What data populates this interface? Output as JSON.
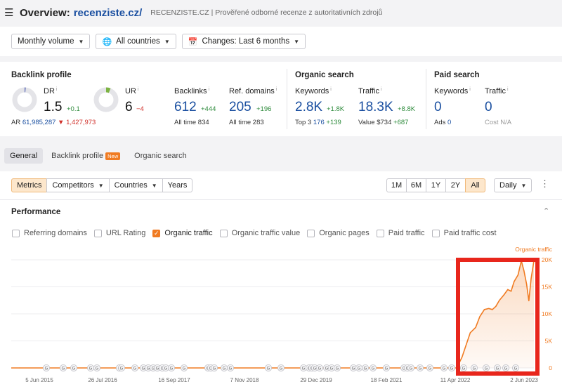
{
  "header": {
    "title_prefix": "Overview:",
    "domain": "recenziste.cz/",
    "description": "RECENZISTE.CZ | Prověřené odborné recenze z autoritativních zdrojů"
  },
  "filters": {
    "volume": "Monthly volume",
    "countries": "All countries",
    "changes": "Changes: Last 6 months"
  },
  "backlink_profile": {
    "title": "Backlink profile",
    "dr": {
      "label": "DR",
      "value": "1.5",
      "delta": "+0.1",
      "gauge_fraction": 0.015
    },
    "ur": {
      "label": "UR",
      "value": "6",
      "delta": "−4",
      "gauge_fraction": 0.06
    },
    "ar": {
      "label": "AR",
      "value": "61,985,287",
      "delta": "1,427,973"
    },
    "backlinks": {
      "label": "Backlinks",
      "value": "612",
      "delta": "+444",
      "all_time_label": "All time",
      "all_time": "834"
    },
    "ref_domains": {
      "label": "Ref. domains",
      "value": "205",
      "delta": "+196",
      "all_time_label": "All time",
      "all_time": "283"
    }
  },
  "organic_search": {
    "title": "Organic search",
    "keywords": {
      "label": "Keywords",
      "value": "2.8K",
      "delta": "+1.8K",
      "top3_label": "Top 3",
      "top3": "176",
      "top3_delta": "+139"
    },
    "traffic": {
      "label": "Traffic",
      "value": "18.3K",
      "delta": "+8.8K",
      "value_label": "Value",
      "value_amount": "$734",
      "value_delta": "+687"
    }
  },
  "paid_search": {
    "title": "Paid search",
    "keywords": {
      "label": "Keywords",
      "value": "0",
      "ads_label": "Ads",
      "ads": "0"
    },
    "traffic": {
      "label": "Traffic",
      "value": "0",
      "cost_label": "Cost",
      "cost": "N/A"
    }
  },
  "tabs": {
    "general": "General",
    "backlink_profile": "Backlink profile",
    "new_badge": "New",
    "organic_search": "Organic search"
  },
  "controls": {
    "metrics": "Metrics",
    "competitors": "Competitors",
    "countries": "Countries",
    "years": "Years",
    "range": [
      "1M",
      "6M",
      "1Y",
      "2Y",
      "All"
    ],
    "range_selected": "All",
    "granularity": "Daily"
  },
  "performance": {
    "title": "Performance",
    "checkboxes": [
      {
        "label": "Referring domains",
        "checked": false
      },
      {
        "label": "URL Rating",
        "checked": false
      },
      {
        "label": "Organic traffic",
        "checked": true
      },
      {
        "label": "Organic traffic value",
        "checked": false
      },
      {
        "label": "Organic pages",
        "checked": false
      },
      {
        "label": "Paid traffic",
        "checked": false
      },
      {
        "label": "Paid traffic cost",
        "checked": false
      }
    ]
  },
  "colors": {
    "accent": "#f07b22",
    "link_blue": "#1a4fa0",
    "positive": "#2e8b3c",
    "negative": "#d0302a",
    "highlight_box": "#e8261c"
  },
  "chart_data": {
    "type": "line",
    "series": [
      {
        "name": "Organic traffic",
        "x": [
          "2015-06-05",
          "2022-02-01",
          "2022-04-15",
          "2022-05-15",
          "2022-06-10",
          "2022-07-01",
          "2022-08-01",
          "2022-08-25",
          "2022-09-20",
          "2022-10-15",
          "2022-11-05",
          "2022-11-25",
          "2022-12-15",
          "2023-01-10",
          "2023-02-01",
          "2023-02-20",
          "2023-03-10",
          "2023-04-01",
          "2023-04-20",
          "2023-05-05",
          "2023-05-20",
          "2023-06-02",
          "2023-06-15",
          "2023-07-01"
        ],
        "values": [
          0,
          0,
          0,
          2000,
          4500,
          6500,
          7500,
          9500,
          10800,
          11000,
          10800,
          11400,
          12500,
          13500,
          14500,
          14200,
          16000,
          17200,
          19800,
          18000,
          15500,
          12400,
          16500,
          19800
        ]
      }
    ],
    "x_tick_labels": [
      "5 Jun 2015",
      "26 Jul 2016",
      "16 Sep 2017",
      "7 Nov 2018",
      "29 Dec 2019",
      "18 Feb 2021",
      "11 Apr 2022",
      "2 Jun 2023"
    ],
    "y_axis": {
      "label": "Organic traffic",
      "ticks": [
        "0",
        "5K",
        "10K",
        "15K",
        "20K"
      ],
      "range": [
        0,
        20000
      ]
    },
    "x_range": [
      "2015-06-05",
      "2023-07-01"
    ],
    "grid": true,
    "event_marker": "G",
    "highlight_region": "last 15 months"
  }
}
